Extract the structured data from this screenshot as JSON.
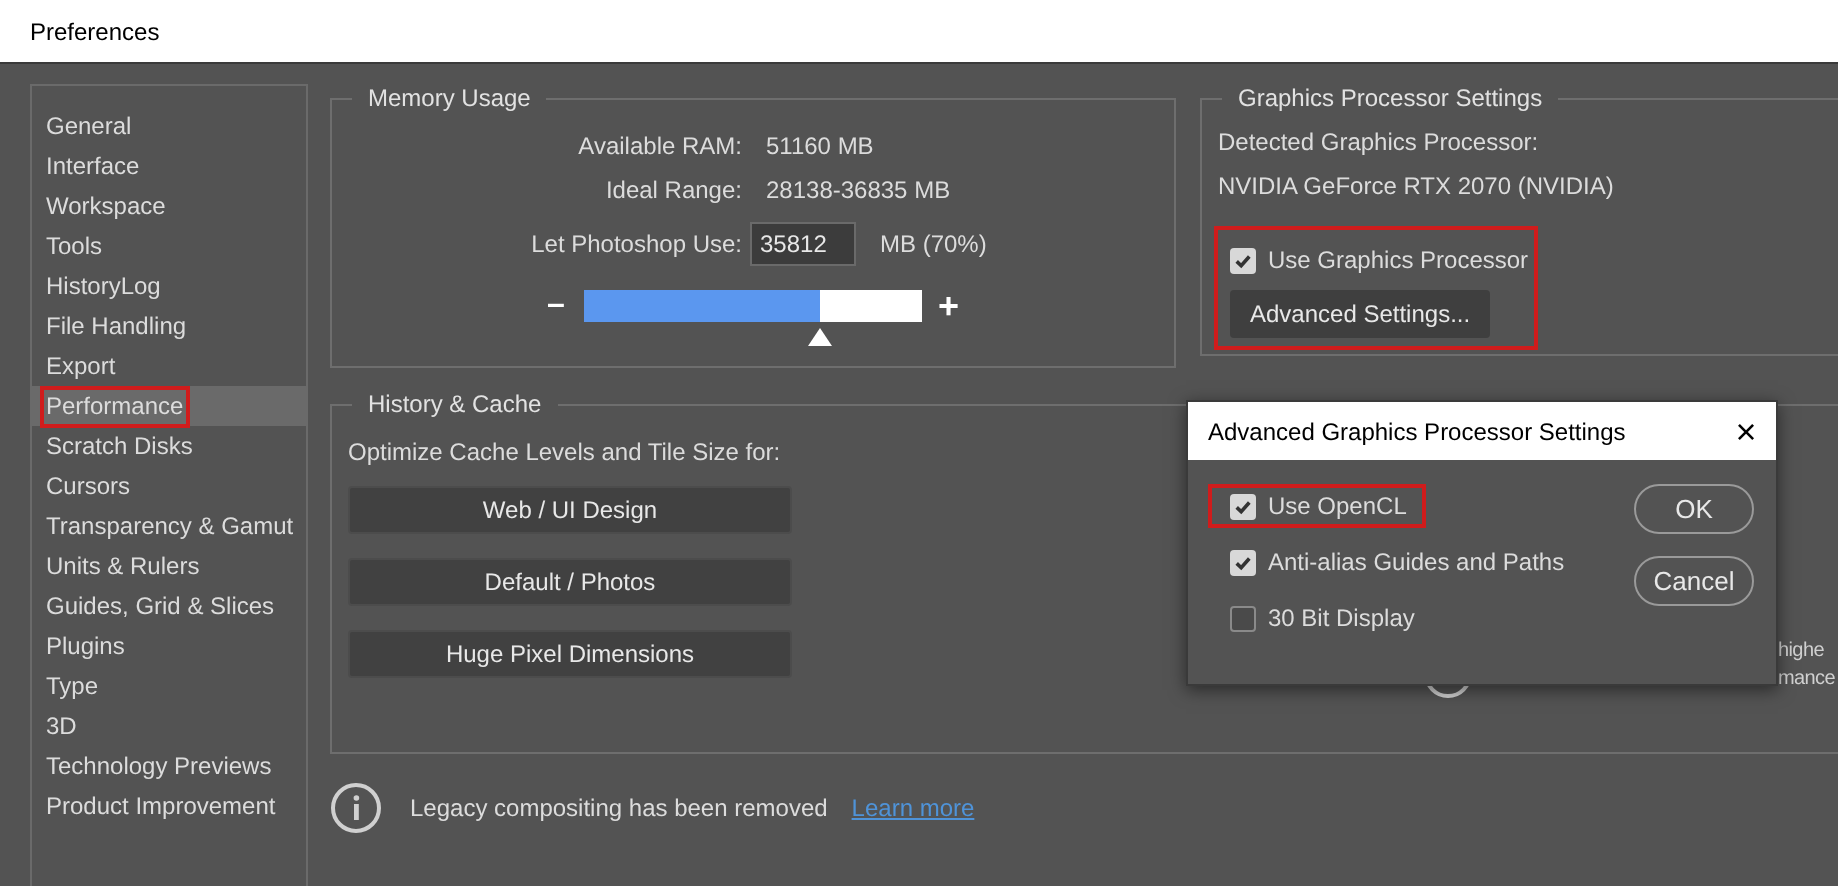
{
  "window": {
    "title": "Preferences"
  },
  "sidebar": {
    "items": [
      {
        "label": "General",
        "selected": false
      },
      {
        "label": "Interface",
        "selected": false
      },
      {
        "label": "Workspace",
        "selected": false
      },
      {
        "label": "Tools",
        "selected": false
      },
      {
        "label": "HistoryLog",
        "selected": false
      },
      {
        "label": "File Handling",
        "selected": false
      },
      {
        "label": "Export",
        "selected": false
      },
      {
        "label": "Performance",
        "selected": true,
        "highlighted": true
      },
      {
        "label": "Scratch Disks",
        "selected": false
      },
      {
        "label": "Cursors",
        "selected": false
      },
      {
        "label": "Transparency & Gamut",
        "selected": false
      },
      {
        "label": "Units & Rulers",
        "selected": false
      },
      {
        "label": "Guides, Grid & Slices",
        "selected": false
      },
      {
        "label": "Plugins",
        "selected": false
      },
      {
        "label": "Type",
        "selected": false
      },
      {
        "label": "3D",
        "selected": false
      },
      {
        "label": "Technology Previews",
        "selected": false
      },
      {
        "label": "Product Improvement",
        "selected": false
      }
    ]
  },
  "memory_usage": {
    "title": "Memory Usage",
    "rows": [
      {
        "label": "Available RAM:",
        "value": "51160 MB"
      },
      {
        "label": "Ideal Range:",
        "value": "28138-36835 MB"
      }
    ],
    "use_label": "Let Photoshop Use:",
    "use_value": "35812",
    "use_unit": "MB (70%)",
    "minus": "–",
    "plus": "+",
    "level": 0.7
  },
  "graphics_processor": {
    "title": "Graphics Processor Settings",
    "detected_label": "Detected Graphics Processor:",
    "detected_value": "NVIDIA GeForce RTX 2070 (NVIDIA)",
    "use_gpu": {
      "label": "Use Graphics Processor",
      "checked": true
    },
    "advanced_button": "Advanced Settings...",
    "highlighted": true
  },
  "history_cache": {
    "title": "History & Cache",
    "prompt": "Optimize Cache Levels and Tile Size for:",
    "buttons": [
      "Web / UI Design",
      "Default / Photos",
      "Huge Pixel Dimensions"
    ]
  },
  "hidden_notice": {
    "line_1": "highe",
    "line_2": "mance"
  },
  "info": {
    "text": "Legacy compositing has been removed",
    "link": "Learn more"
  },
  "dialog": {
    "title": "Advanced Graphics Processor Settings",
    "close": "×",
    "options": [
      {
        "label": "Use OpenCL",
        "checked": true,
        "highlighted": true
      },
      {
        "label": "Anti-alias Guides and Paths",
        "checked": true,
        "highlighted": false
      },
      {
        "label": "30 Bit Display",
        "checked": false,
        "highlighted": false
      }
    ],
    "buttons": [
      "OK",
      "Cancel"
    ]
  }
}
